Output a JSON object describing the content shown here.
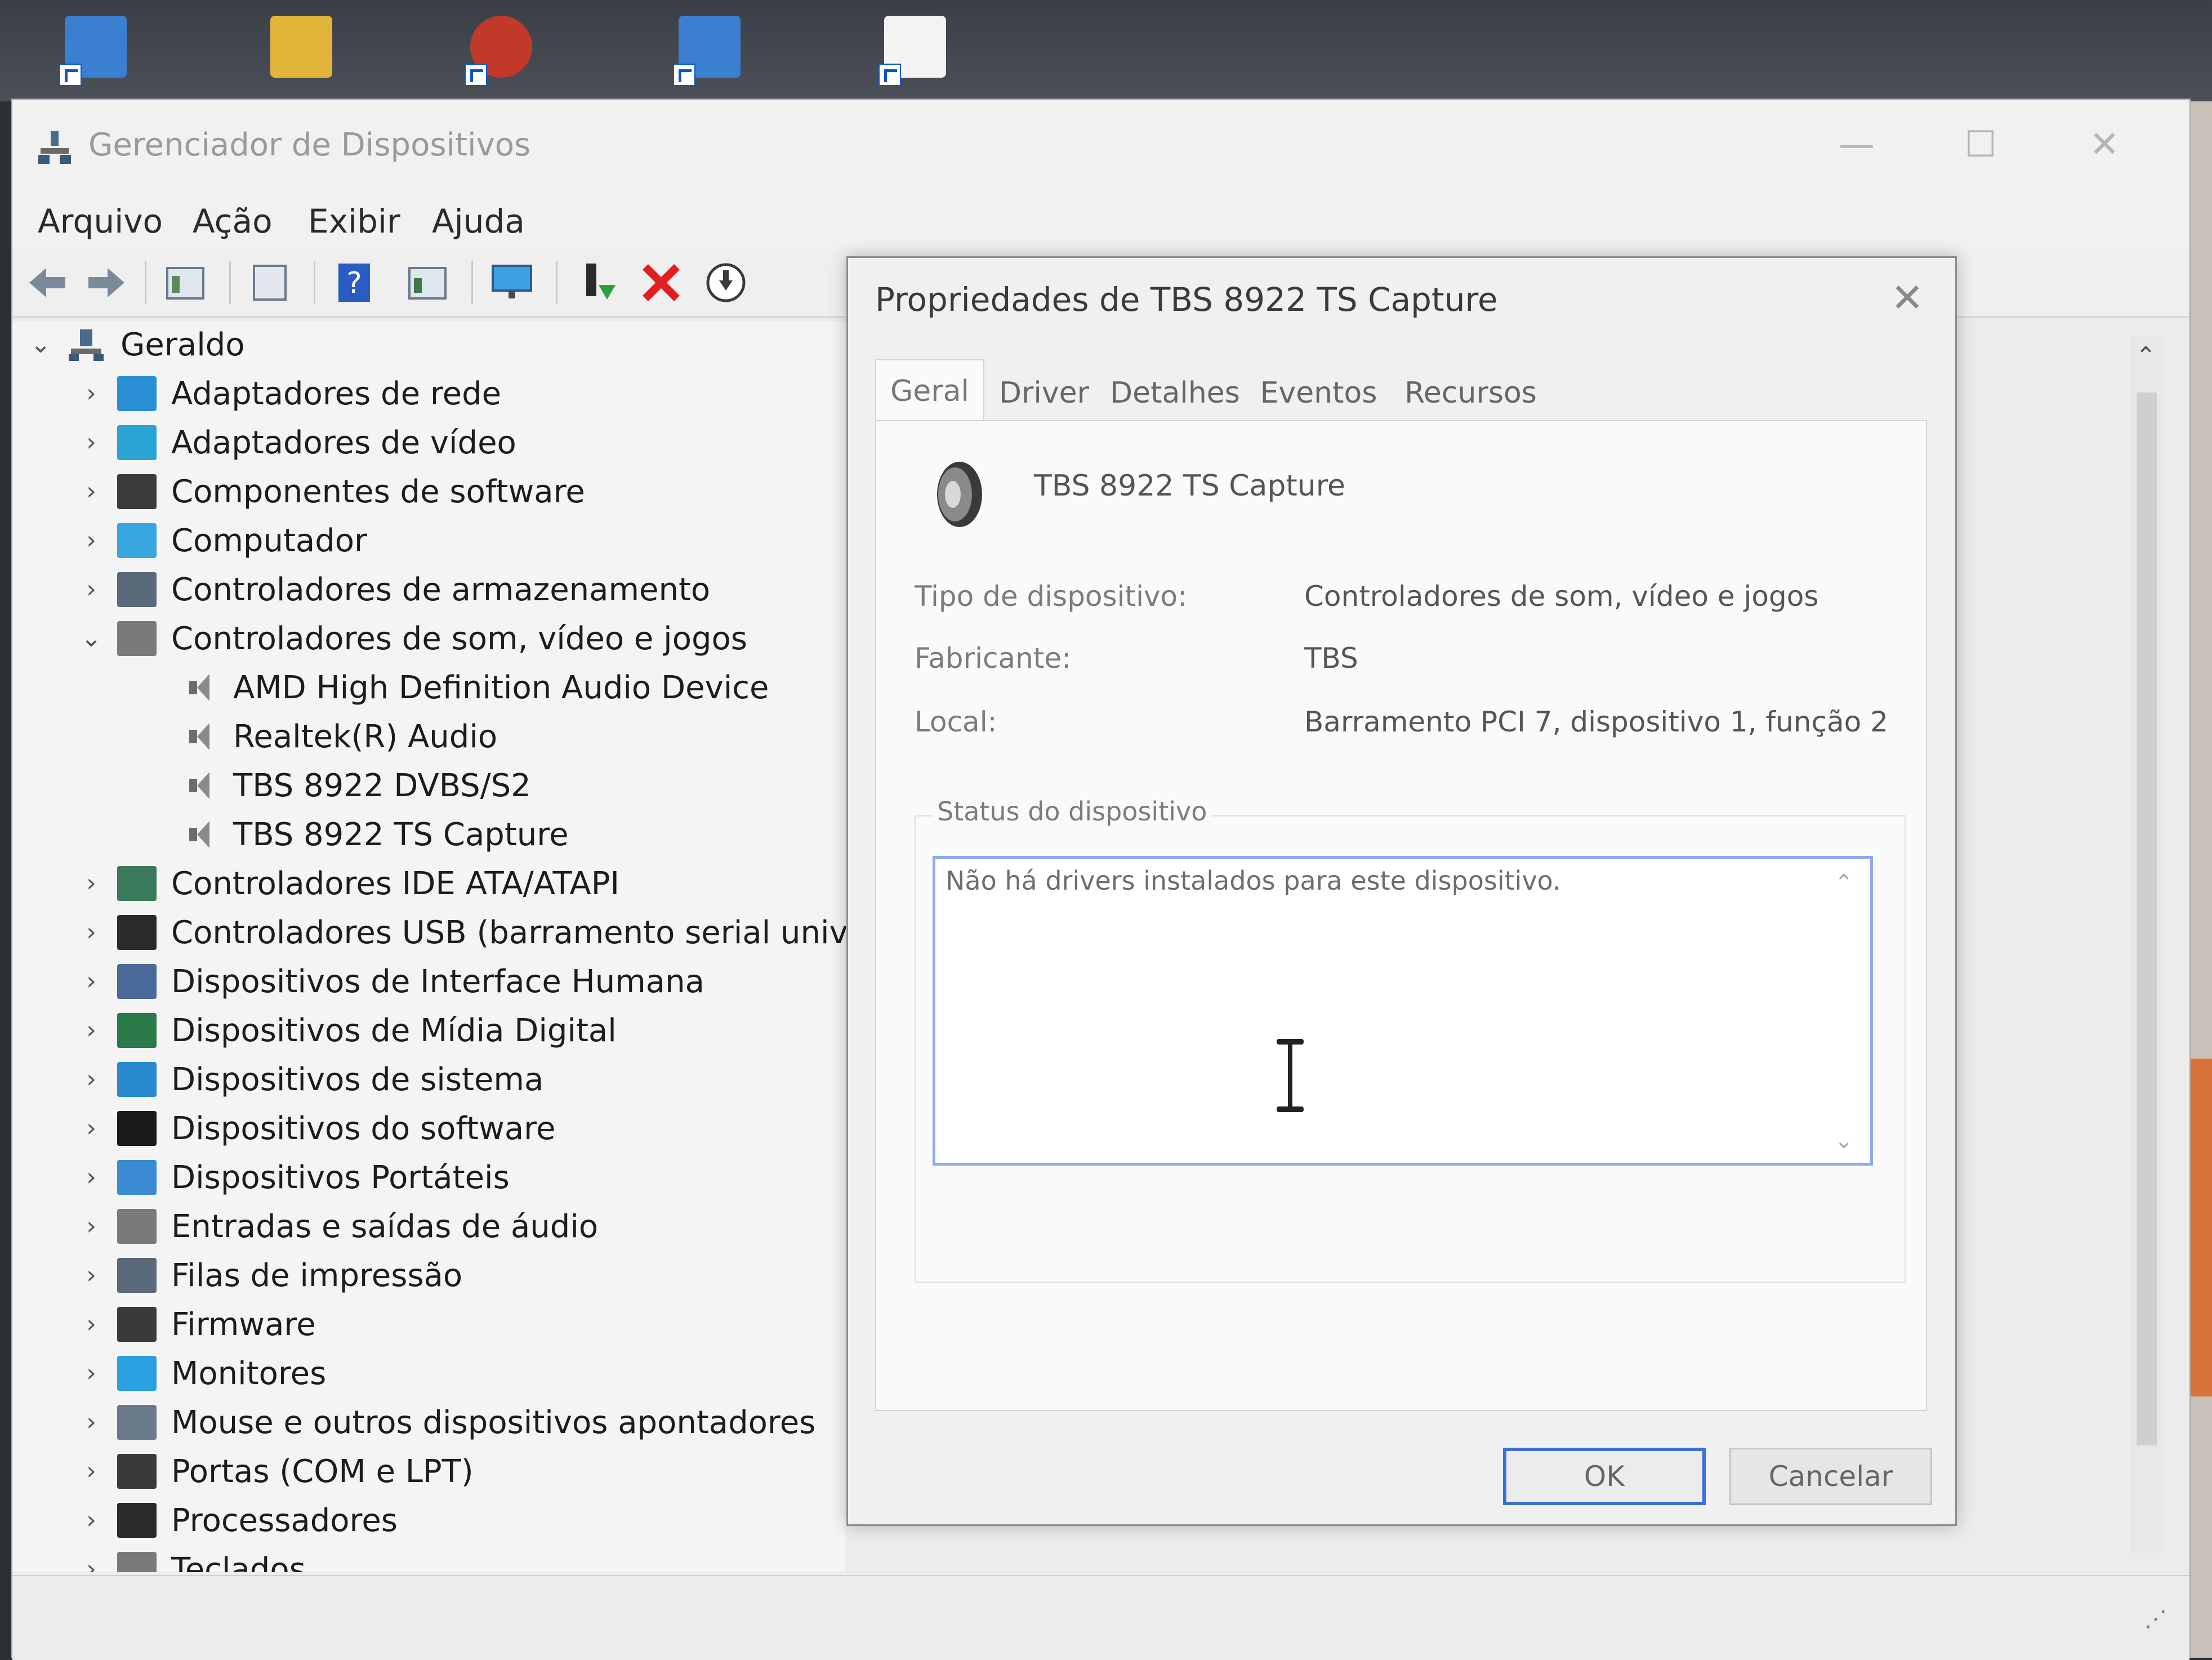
{
  "window": {
    "title": "Gerenciador de Dispositivos",
    "controls": {
      "minimize": "—",
      "maximize": "☐",
      "close": "✕"
    }
  },
  "menu": [
    "Arquivo",
    "Ação",
    "Exibir",
    "Ajuda"
  ],
  "toolbar_icons": [
    "back-icon",
    "forward-icon",
    "properties-icon",
    "show-hide-icon",
    "help-icon",
    "view-icon",
    "monitor-icon",
    "update-driver-icon",
    "uninstall-icon",
    "download-icon"
  ],
  "tree": {
    "root": "Geraldo",
    "items": [
      {
        "label": "Adaptadores de rede",
        "color": "#2a8fd4"
      },
      {
        "label": "Adaptadores de vídeo",
        "color": "#2aa4d4"
      },
      {
        "label": "Componentes de software",
        "color": "#3b3b3b"
      },
      {
        "label": "Computador",
        "color": "#3aa6e0"
      },
      {
        "label": "Controladores de armazenamento",
        "color": "#5a6a7a"
      },
      {
        "label": "Controladores de som, vídeo e jogos",
        "color": "#7a7a7a",
        "expanded": true,
        "children": [
          "AMD High Definition Audio Device",
          "Realtek(R) Audio",
          "TBS 8922 DVBS/S2",
          "TBS 8922 TS Capture"
        ]
      },
      {
        "label": "Controladores IDE ATA/ATAPI",
        "color": "#3a7a5a"
      },
      {
        "label": "Controladores USB (barramento serial universa",
        "color": "#2a2a2a"
      },
      {
        "label": "Dispositivos de Interface Humana",
        "color": "#4a6a9a"
      },
      {
        "label": "Dispositivos de Mídia Digital",
        "color": "#2a7a4a"
      },
      {
        "label": "Dispositivos de sistema",
        "color": "#2a8ad0"
      },
      {
        "label": "Dispositivos do software",
        "color": "#1a1a1a"
      },
      {
        "label": "Dispositivos Portáteis",
        "color": "#3a8ad4"
      },
      {
        "label": "Entradas e saídas de áudio",
        "color": "#7a7a7a"
      },
      {
        "label": "Filas de impressão",
        "color": "#5a6a7a"
      },
      {
        "label": "Firmware",
        "color": "#3a3a3a"
      },
      {
        "label": "Monitores",
        "color": "#2aa0e0"
      },
      {
        "label": "Mouse e outros dispositivos apontadores",
        "color": "#6a7a8a"
      },
      {
        "label": "Portas (COM e LPT)",
        "color": "#3a3a3a"
      },
      {
        "label": "Processadores",
        "color": "#2a2a2a"
      },
      {
        "label": "Teclados",
        "color": "#7a7a7a"
      }
    ]
  },
  "dialog": {
    "title": "Propriedades de TBS 8922 TS Capture",
    "close": "✕",
    "tabs": [
      "Geral",
      "Driver",
      "Detalhes",
      "Eventos",
      "Recursos"
    ],
    "active_tab": "Geral",
    "device_name": "TBS 8922 TS Capture",
    "props": [
      {
        "label": "Tipo de dispositivo:",
        "value": "Controladores de som, vídeo e jogos"
      },
      {
        "label": "Fabricante:",
        "value": "TBS"
      },
      {
        "label": "Local:",
        "value": "Barramento PCI 7, dispositivo 1, função 2"
      }
    ],
    "status_legend": "Status do dispositivo",
    "status_text": "Não há drivers instalados para este dispositivo.",
    "ok_label": "OK",
    "cancel_label": "Cancelar"
  }
}
